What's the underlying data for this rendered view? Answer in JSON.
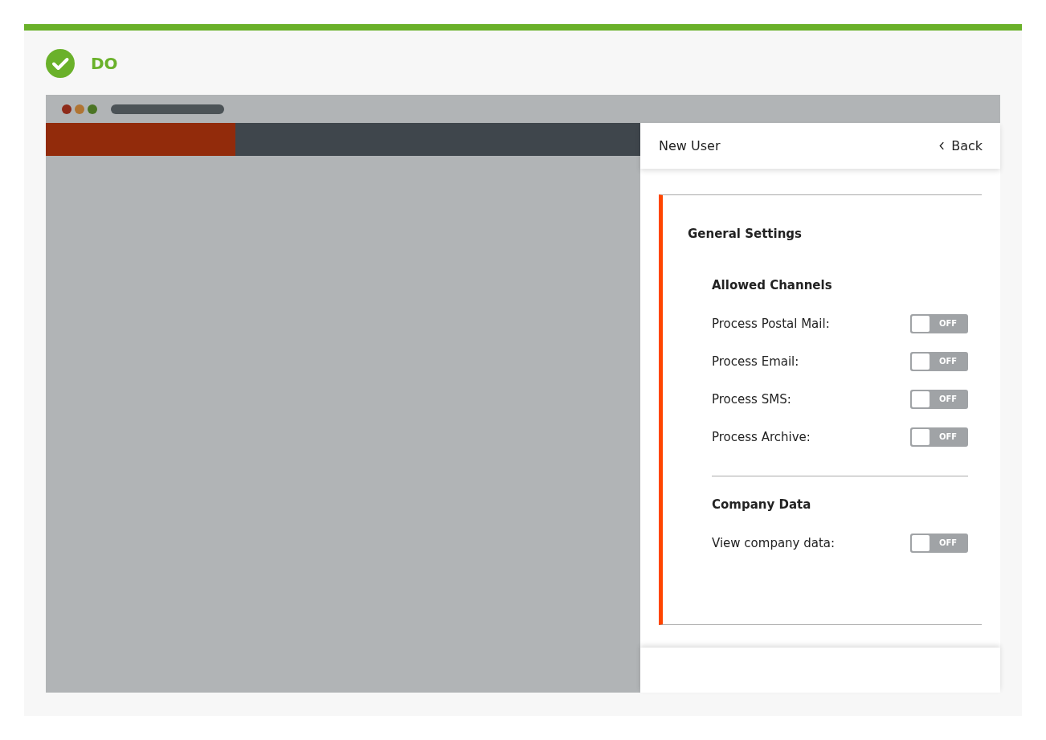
{
  "banner": {
    "label": "DO"
  },
  "panel": {
    "title": "New User",
    "back": "Back"
  },
  "section": {
    "title": "General Settings",
    "groups": [
      {
        "title": "Allowed Channels",
        "settings": [
          {
            "label": "Process Postal Mail:",
            "on": false,
            "state_label": "OFF"
          },
          {
            "label": "Process Email:",
            "on": false,
            "state_label": "OFF"
          },
          {
            "label": "Process SMS:",
            "on": false,
            "state_label": "OFF"
          },
          {
            "label": "Process Archive:",
            "on": false,
            "state_label": "OFF"
          }
        ]
      },
      {
        "title": "Company Data",
        "settings": [
          {
            "label": "View company data:",
            "on": false,
            "state_label": "OFF"
          }
        ]
      }
    ]
  }
}
